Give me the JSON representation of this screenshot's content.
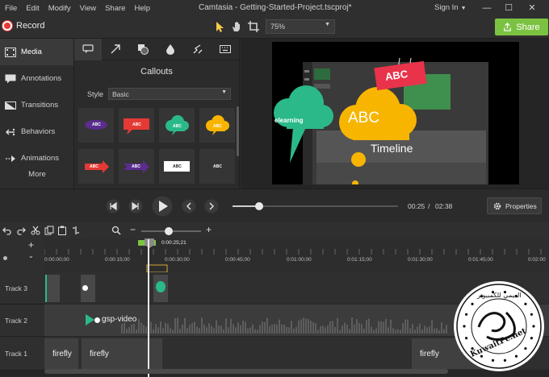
{
  "menubar": {
    "menus": [
      "File",
      "Edit",
      "Modify",
      "View",
      "Share",
      "Help"
    ],
    "window_title": "Camtasia - Getting-Started-Project.tscproj*",
    "signin": "Sign In",
    "window_buttons": [
      "minimize-icon",
      "maximize-icon",
      "close-icon"
    ]
  },
  "toolbar": {
    "record_label": "Record",
    "zoom_value": "75%",
    "share_label": "Share",
    "tools": [
      "pointer-icon",
      "hand-icon",
      "crop-icon"
    ]
  },
  "left_nav": {
    "items": [
      "Media",
      "Annotations",
      "Transitions",
      "Behaviors",
      "Animations"
    ],
    "more_label": "More"
  },
  "callouts_panel": {
    "title": "Callouts",
    "style_label": "Style",
    "style_value": "Basic",
    "tabs": [
      "callout-icon",
      "arrow-icon",
      "shape-icon",
      "blur-icon",
      "sketch-icon",
      "keystroke-icon"
    ],
    "thumb_texts": [
      "ABC",
      "ABC",
      "ABC",
      "ABC",
      "ABC",
      "ABC",
      "ABC",
      "ABC"
    ]
  },
  "canvas": {
    "bubble_left": "elearning",
    "bubble_main": "ABC",
    "sign": "ABC",
    "caption": "Timeline"
  },
  "playback": {
    "current_time": "00:25",
    "separator": "/",
    "total_time": "02:38",
    "properties_label": "Properties",
    "scrub_progress": 0.16
  },
  "timeline": {
    "playhead_time": "0:00:25;21",
    "ticks": [
      "0:00:00;00",
      "0:00:15;00",
      "0:00:30;00",
      "0:00:45;00",
      "0:01:00;00",
      "0:01:15;00",
      "0:01:30;00",
      "0:01:45;00",
      "0:02:00"
    ],
    "tracks": [
      {
        "label": "Track 3"
      },
      {
        "label": "Track 2",
        "clip": "gsp-video"
      },
      {
        "label": "Track 1",
        "clips": [
          "firefly",
          "firefly",
          "firefly"
        ]
      }
    ]
  },
  "watermark": {
    "arabic": "العيمي للكمبيوتر",
    "site": "KuwaitPc.net"
  },
  "colors": {
    "accent_green": "#7cc242",
    "record_red": "#e53935",
    "teal_bubble": "#2bb98a",
    "orange_bubble": "#f7b500",
    "sign_red": "#e8334a"
  }
}
